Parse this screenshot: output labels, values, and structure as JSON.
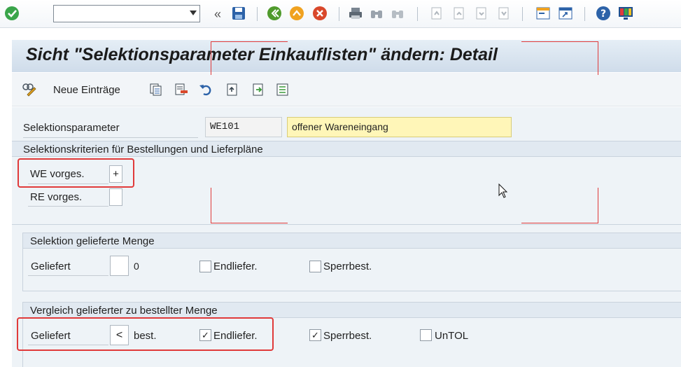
{
  "title": "Sicht \"Selektionsparameter  Einkauflisten\" ändern: Detail",
  "app_toolbar": {
    "new_entries": "Neue Einträge"
  },
  "fields": {
    "selektionsparameter": {
      "label": "Selektionsparameter",
      "code": "WE101",
      "description": "offener Wareneingang"
    }
  },
  "group_criteria": {
    "title": "Selektionskriterien für Bestellungen und Lieferpläne",
    "we_label": "WE vorges.",
    "we_value": "+",
    "re_label": "RE vorges.",
    "re_value": ""
  },
  "group_delivered": {
    "title": "Selektion gelieferte Menge",
    "geliefert_label": "Geliefert",
    "geliefert_op": "",
    "geliefert_value": "0",
    "endliefer_label": "Endliefer.",
    "endliefer_checked": false,
    "sperrbest_label": "Sperrbest.",
    "sperrbest_checked": false
  },
  "group_compare": {
    "title": "Vergleich gelieferter zu bestellter Menge",
    "geliefert_label": "Geliefert",
    "geliefert_op": "<",
    "geliefert_value": "best.",
    "endliefer_label": "Endliefer.",
    "endliefer_check": "✓",
    "sperrbest_label": "Sperrbest.",
    "sperrbest_check": "✓",
    "untol_label": "UnTOL",
    "untol_check": ""
  },
  "colors": {
    "highlight": "#e03a3a",
    "title_bg": "#cfdcea",
    "yellow_field": "#fff6b8"
  }
}
